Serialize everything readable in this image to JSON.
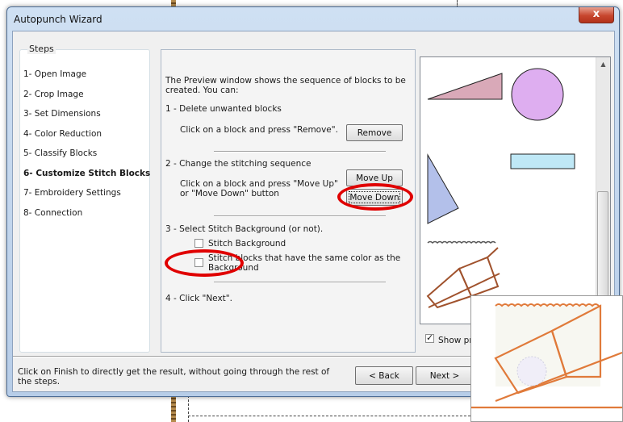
{
  "window": {
    "title": "Autopunch Wizard",
    "close_glyph": "x"
  },
  "steps": {
    "legend": "Steps",
    "items": [
      {
        "label": "1- Open Image",
        "active": false
      },
      {
        "label": "2- Crop Image",
        "active": false
      },
      {
        "label": "3- Set Dimensions",
        "active": false
      },
      {
        "label": "4- Color Reduction",
        "active": false
      },
      {
        "label": "5- Classify Blocks",
        "active": false
      },
      {
        "label": "6- Customize Stitch Blocks",
        "active": true
      },
      {
        "label": "7- Embroidery Settings",
        "active": false
      },
      {
        "label": "8- Connection",
        "active": false
      }
    ]
  },
  "main": {
    "intro_line1": "The Preview window shows the sequence of blocks to be",
    "intro_line2": "created. You can:",
    "step1_title": "1 - Delete unwanted blocks",
    "step1_hint": "Click on a block and press \"Remove\".",
    "remove_label": "Remove",
    "step2_title": "2 - Change the stitching sequence",
    "step2_hint_line1": "Click on a block and press \"Move Up\"",
    "step2_hint_line2": "or \"Move Down\" button",
    "move_up_label": "Move Up",
    "move_down_label": "Move Down",
    "step3_title": "3 - Select Stitch Background (or not).",
    "stitch_background_label": "Stitch Background",
    "stitch_blocks_label_line1": "Stitch blocks that have the same color as the",
    "stitch_blocks_label_line2": "Background",
    "step4_title": "4 - Click \"Next\"."
  },
  "preview": {
    "show_preview_label": "Show pre",
    "show_preview_checked": true
  },
  "footer": {
    "line1": "Click on Finish to directly get the result, without going through the rest of",
    "line2": "the steps.",
    "back_label": "< Back",
    "next_label": "Next >"
  },
  "colors": {
    "triangle_fill": "#d9a9b8",
    "circle_fill": "#deaef0",
    "rect_fill": "#bfe8f6",
    "triangle2_fill": "#b3c0ea",
    "thread": "#a0522d",
    "highlight": "#e00000"
  },
  "icons": {
    "close": "close-icon",
    "scroll_up": "scroll-up-arrow-icon",
    "scroll_down": "scroll-down-arrow-icon"
  }
}
